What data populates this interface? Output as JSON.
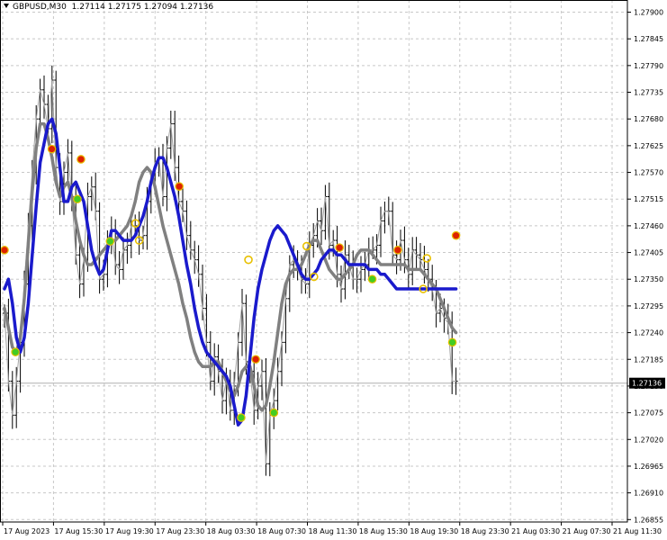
{
  "header": {
    "symbol": "GBPUSD,M30",
    "open": "1.27114",
    "high": "1.27175",
    "low": "1.27094",
    "close": "1.27136"
  },
  "colors": {
    "background": "#ffffff",
    "grid": "#c8c8c8",
    "price_bars": "#000000",
    "thin_line": "#a0a0a0",
    "gray_ma": "#808080",
    "blue_ma": "#1a1acc",
    "marker_red": "#dd2200",
    "marker_green": "#44cc22",
    "marker_yellow_ring": "#e8c000",
    "current_price_label_bg": "#000000"
  },
  "chart_data": {
    "type": "line",
    "symbol": "GBPUSD",
    "timeframe": "M30",
    "ylim": [
      1.2685,
      1.27925
    ],
    "y_ticks": [
      "1.27900",
      "1.27845",
      "1.27790",
      "1.27735",
      "1.27680",
      "1.27625",
      "1.27570",
      "1.27515",
      "1.27460",
      "1.27405",
      "1.27350",
      "1.27295",
      "1.27240",
      "1.27185",
      "1.27130",
      "1.27075",
      "1.27020",
      "1.26965",
      "1.26910",
      "1.26855"
    ],
    "x_ticks": [
      "17 Aug 2023",
      "17 Aug 15:30",
      "17 Aug 19:30",
      "17 Aug 23:30",
      "18 Aug 03:30",
      "18 Aug 07:30",
      "18 Aug 11:30",
      "18 Aug 15:30",
      "18 Aug 19:30",
      "18 Aug 23:30",
      "21 Aug 03:30",
      "21 Aug 07:30",
      "21 Aug 11:30"
    ],
    "current_price": "1.27136",
    "bar_count": 115,
    "bar_step_hours": 0.5,
    "series": [
      {
        "role": "price_close_line",
        "color": "#a0a0a0",
        "values": [
          1.2728,
          1.2714,
          1.2707,
          1.2714,
          1.2722,
          1.2734,
          1.2746,
          1.2757,
          1.2768,
          1.2774,
          1.2771,
          1.2766,
          1.2776,
          1.2758,
          1.2751,
          1.2757,
          1.2761,
          1.2752,
          1.274,
          1.2734,
          1.2739,
          1.2752,
          1.2754,
          1.2749,
          1.2735,
          1.2736,
          1.2743,
          1.2745,
          1.2738,
          1.2737,
          1.2741,
          1.2742,
          1.2746,
          1.2746,
          1.2743,
          1.2744,
          1.2751,
          1.2755,
          1.2759,
          1.276,
          1.2752,
          1.2762,
          1.2767,
          1.2758,
          1.2751,
          1.2749,
          1.2744,
          1.2741,
          1.2739,
          1.2736,
          1.2729,
          1.2722,
          1.2714,
          1.2719,
          1.2716,
          1.271,
          1.2714,
          1.2708,
          1.2713,
          1.2722,
          1.273,
          1.2718,
          1.2716,
          1.2708,
          1.2713,
          1.2716,
          1.2697,
          1.2707,
          1.271,
          1.2716,
          1.2722,
          1.2731,
          1.2738,
          1.2739,
          1.2737,
          1.2735,
          1.2734,
          1.2742,
          1.2744,
          1.2747,
          1.2745,
          1.2752,
          1.2742,
          1.2743,
          1.2736,
          1.2733,
          1.274,
          1.2738,
          1.2735,
          1.2735,
          1.2737,
          1.2738,
          1.2741,
          1.2741,
          1.2742,
          1.2747,
          1.2749,
          1.2749,
          1.274,
          1.2739,
          1.2743,
          1.2739,
          1.2736,
          1.2741,
          1.274,
          1.2739,
          1.2737,
          1.2735,
          1.2733,
          1.2728,
          1.2729,
          1.2727,
          1.2726,
          1.2714,
          1.2714
        ]
      },
      {
        "role": "gray_moving_average",
        "color": "#808080",
        "values": [
          1.2729,
          1.2725,
          1.2721,
          1.272,
          1.2723,
          1.2731,
          1.2742,
          1.2753,
          1.2762,
          1.2767,
          1.2767,
          1.2764,
          1.276,
          1.2755,
          1.2752,
          1.2754,
          1.2755,
          1.2752,
          1.2747,
          1.2743,
          1.274,
          1.2738,
          1.2738,
          1.2739,
          1.274,
          1.2741,
          1.2742,
          1.2743,
          1.2743,
          1.2744,
          1.2745,
          1.2746,
          1.2748,
          1.2751,
          1.2755,
          1.2757,
          1.2758,
          1.2757,
          1.2754,
          1.275,
          1.2746,
          1.2743,
          1.274,
          1.2737,
          1.2734,
          1.273,
          1.2727,
          1.2723,
          1.272,
          1.2718,
          1.2717,
          1.2717,
          1.2717,
          1.2718,
          1.2718,
          1.2716,
          1.2714,
          1.2712,
          1.2711,
          1.2713,
          1.2716,
          1.2717,
          1.2717,
          1.2713,
          1.2709,
          1.2708,
          1.2709,
          1.2713,
          1.2718,
          1.2724,
          1.273,
          1.2734,
          1.2736,
          1.2737,
          1.2737,
          1.2738,
          1.274,
          1.2742,
          1.2743,
          1.2743,
          1.2741,
          1.2739,
          1.2737,
          1.2736,
          1.2735,
          1.2735,
          1.2736,
          1.2737,
          1.2738,
          1.274,
          1.2741,
          1.2741,
          1.2741,
          1.274,
          1.2739,
          1.2738,
          1.2738,
          1.2738,
          1.2738,
          1.2738,
          1.2738,
          1.2738,
          1.2737,
          1.2737,
          1.2737,
          1.2737,
          1.2736,
          1.2735,
          1.2734,
          1.2733,
          1.2731,
          1.2729,
          1.2727,
          1.2725,
          1.2724
        ]
      },
      {
        "role": "blue_moving_average",
        "color": "#1a1acc",
        "values": [
          1.2733,
          1.2735,
          1.273,
          1.2723,
          1.272,
          1.2723,
          1.273,
          1.274,
          1.275,
          1.2759,
          1.2763,
          1.2767,
          1.2768,
          1.2765,
          1.2758,
          1.2751,
          1.2751,
          1.2754,
          1.2755,
          1.2753,
          1.2751,
          1.2746,
          1.2741,
          1.2738,
          1.2736,
          1.2737,
          1.2741,
          1.2745,
          1.2745,
          1.2744,
          1.2743,
          1.2743,
          1.2743,
          1.2744,
          1.2746,
          1.2748,
          1.2751,
          1.2755,
          1.2758,
          1.276,
          1.276,
          1.2758,
          1.2755,
          1.2752,
          1.2748,
          1.2743,
          1.2738,
          1.2734,
          1.2729,
          1.2725,
          1.2722,
          1.272,
          1.2719,
          1.2718,
          1.2717,
          1.2716,
          1.2715,
          1.2713,
          1.2709,
          1.2705,
          1.2706,
          1.2711,
          1.2719,
          1.2727,
          1.2733,
          1.2737,
          1.274,
          1.2743,
          1.2745,
          1.2746,
          1.2745,
          1.2744,
          1.2742,
          1.274,
          1.2738,
          1.2736,
          1.2735,
          1.2735,
          1.2736,
          1.2737,
          1.2739,
          1.274,
          1.2741,
          1.2741,
          1.274,
          1.274,
          1.2739,
          1.2738,
          1.2738,
          1.2738,
          1.2738,
          1.2738,
          1.2737,
          1.2737,
          1.2737,
          1.2736,
          1.2736,
          1.2735,
          1.2734,
          1.2733,
          1.2733,
          1.2733,
          1.2733,
          1.2733,
          1.2733,
          1.2733,
          1.2733,
          1.2733,
          1.2733,
          1.2733,
          1.2733,
          1.2733,
          1.2733,
          1.2733,
          1.2733
        ]
      }
    ],
    "markers": [
      {
        "bar": 0,
        "price": 1.2741,
        "kind": "red"
      },
      {
        "bar": 3,
        "price": 1.272,
        "kind": "green"
      },
      {
        "bar": 13,
        "price": 1.27618,
        "kind": "red"
      },
      {
        "bar": 20,
        "price": 1.27515,
        "kind": "green"
      },
      {
        "bar": 21,
        "price": 1.27597,
        "kind": "red"
      },
      {
        "bar": 29,
        "price": 1.27428,
        "kind": "green"
      },
      {
        "bar": 36,
        "price": 1.27465,
        "kind": "yellow"
      },
      {
        "bar": 37,
        "price": 1.2743,
        "kind": "yellow"
      },
      {
        "bar": 48,
        "price": 1.27541,
        "kind": "red"
      },
      {
        "bar": 67,
        "price": 1.2739,
        "kind": "yellow"
      },
      {
        "bar": 69,
        "price": 1.27185,
        "kind": "red"
      },
      {
        "bar": 65,
        "price": 1.27065,
        "kind": "green"
      },
      {
        "bar": 74,
        "price": 1.27075,
        "kind": "green"
      },
      {
        "bar": 83,
        "price": 1.27418,
        "kind": "yellow"
      },
      {
        "bar": 85,
        "price": 1.27355,
        "kind": "yellow"
      },
      {
        "bar": 92,
        "price": 1.27415,
        "kind": "red"
      },
      {
        "bar": 101,
        "price": 1.2735,
        "kind": "green"
      },
      {
        "bar": 108,
        "price": 1.2741,
        "kind": "red"
      },
      {
        "bar": 116,
        "price": 1.27393,
        "kind": "yellow"
      },
      {
        "bar": 115,
        "price": 1.2733,
        "kind": "yellow"
      },
      {
        "bar": 123,
        "price": 1.2722,
        "kind": "green"
      },
      {
        "bar": 124,
        "price": 1.2744,
        "kind": "red"
      }
    ]
  }
}
